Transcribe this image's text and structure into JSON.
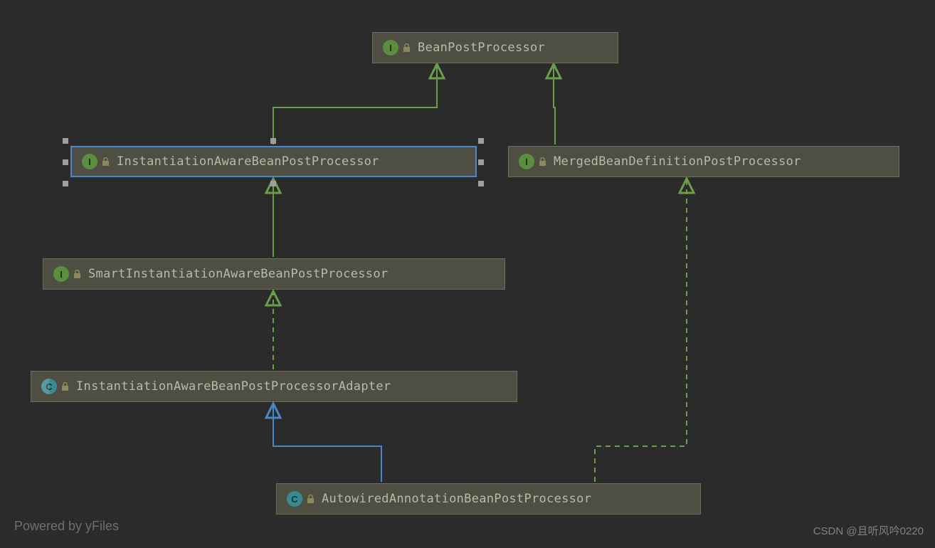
{
  "nodes": {
    "bpp": {
      "label": "BeanPostProcessor",
      "type": "I"
    },
    "iabpp": {
      "label": "InstantiationAwareBeanPostProcessor",
      "type": "I"
    },
    "mbdpp": {
      "label": "MergedBeanDefinitionPostProcessor",
      "type": "I"
    },
    "siabpp": {
      "label": "SmartInstantiationAwareBeanPostProcessor",
      "type": "I"
    },
    "iabppa": {
      "label": "InstantiationAwareBeanPostProcessorAdapter",
      "type": "C"
    },
    "aabpp": {
      "label": "AutowiredAnnotationBeanPostProcessor",
      "type": "C"
    }
  },
  "footer": "Powered by yFiles",
  "watermark": "CSDN @且听风吟0220"
}
